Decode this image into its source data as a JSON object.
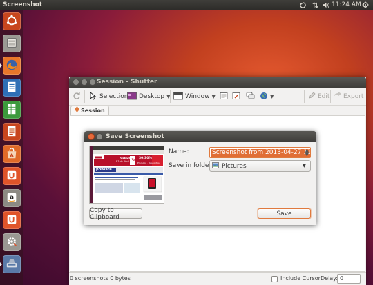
{
  "panel": {
    "title": "Screenshot",
    "clock": "11:24 AM",
    "tray_icons": [
      "sync-icon",
      "network-icon",
      "volume-icon",
      "power-gear-icon"
    ]
  },
  "launcher": {
    "items": [
      {
        "name": "dash-home",
        "icon": "ubuntu-logo-icon",
        "color": "#c8461e"
      },
      {
        "name": "files",
        "icon": "file-cabinet-icon",
        "color": "#9b9a94"
      },
      {
        "name": "firefox",
        "icon": "firefox-icon",
        "color": "#e8772a"
      },
      {
        "name": "libreoffice-writer",
        "icon": "writer-doc-icon",
        "color": "#2e6fb5"
      },
      {
        "name": "libreoffice-calc",
        "icon": "calc-sheet-icon",
        "color": "#3c9a3c"
      },
      {
        "name": "libreoffice-impress",
        "icon": "impress-slide-icon",
        "color": "#c8461e"
      },
      {
        "name": "ubuntu-software-center",
        "icon": "software-center-bag-icon",
        "color": "#e06a28"
      },
      {
        "name": "ubuntu-one",
        "icon": "ubuntu-one-icon",
        "color": "#e0542a"
      },
      {
        "name": "amazon",
        "icon": "amazon-icon",
        "color": "#8c8a84"
      },
      {
        "name": "ubuntu-one-music",
        "icon": "ubuntu-one-music-icon",
        "color": "#e0542a"
      },
      {
        "name": "system-settings",
        "icon": "settings-gear-icon",
        "color": "#9a9892"
      },
      {
        "name": "shutter",
        "icon": "shutter-scanner-icon",
        "color": "#5a7aa8"
      }
    ]
  },
  "shutter": {
    "title": "Session - Shutter",
    "toolbar": {
      "selection": "Selection",
      "desktop": "Desktop",
      "window": "Window",
      "edit": "Edit",
      "export": "Export"
    },
    "tab_label": "Session",
    "status": {
      "count": "0 screenshots  0 bytes",
      "include_cursor": "Include Cursor",
      "delay_label": "Delay:",
      "delay_value": "0"
    }
  },
  "dialog": {
    "title": "Save Screenshot",
    "name_label": "Name:",
    "name_value": "Screenshot from 2013-04-27 11:23:58",
    "folder_label": "Save in folder:",
    "folder_value": "Pictures",
    "copy_button": "Copy to Clipboard",
    "save_button": "Save",
    "thumbnail": {
      "banner_left": "Sábado",
      "banner_date": "27 de Abril à",
      "banner_number": "30",
      "banner_pct": "30:30%",
      "banner_sub": "Produtos · Descontos",
      "site_logo": "pplware"
    }
  },
  "colors": {
    "accent_orange": "#e06e36",
    "panel_dark": "#3c3b37",
    "window_bg": "#f2f1f0"
  }
}
